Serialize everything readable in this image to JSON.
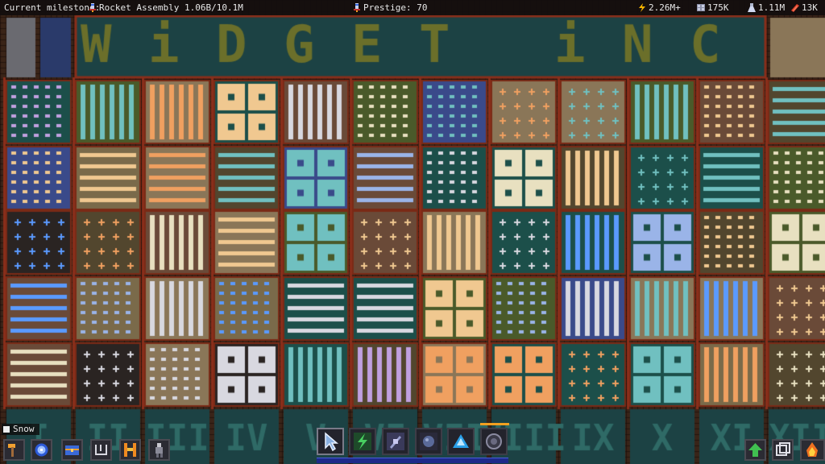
{
  "topbar": {
    "milestone_label": "Current milestone:",
    "milestone_item": "Rocket Assembly",
    "milestone_progress": "1.06B/10.1M",
    "prestige": "Prestige: 70",
    "energy": "2.26M+",
    "storage": "175K",
    "research": "1.11M",
    "money": "13K",
    "colors": {
      "bar_bg": "#120e0e",
      "text": "#e8e8e8",
      "energy_icon": "#f6b400",
      "money_icon": "#e0402a"
    }
  },
  "title_banner": {
    "text": "WiDGET iNC",
    "color": "#6b6f2a",
    "background": "#1f4a4a"
  },
  "column_numerals": [
    "I",
    "II",
    "III",
    "IV",
    "V",
    "VI",
    "VII",
    "VIII",
    "IX",
    "X",
    "XI",
    "XII"
  ],
  "snow_toggle": {
    "label": "Snow",
    "checked": false
  },
  "left_toolbar": [
    {
      "icon": "hammer-icon"
    },
    {
      "icon": "compass-icon"
    },
    {
      "icon": "chest-icon"
    },
    {
      "icon": "grid-icon"
    },
    {
      "icon": "tower-icon"
    },
    {
      "icon": "worker-icon"
    }
  ],
  "hotbar": [
    {
      "icon": "cursor-icon",
      "selected": true
    },
    {
      "icon": "lightning-icon",
      "selected": false
    },
    {
      "icon": "circuit-icon",
      "selected": false
    },
    {
      "icon": "asteroid-icon",
      "selected": false
    },
    {
      "icon": "triangle-icon",
      "selected": false
    },
    {
      "icon": "ring-icon",
      "selected": false
    }
  ],
  "right_toolbar": [
    {
      "icon": "upgrade-icon"
    },
    {
      "icon": "copy-icon"
    },
    {
      "icon": "fire-icon"
    }
  ],
  "palette": {
    "grid_line": "#5a2a1a",
    "beige": "#8a7658",
    "dark": "#2a2422",
    "olive": "#4a5a2a",
    "teal": "#1c4f4a",
    "blue": "#3a4a8a",
    "brown": "#6a4a38"
  }
}
